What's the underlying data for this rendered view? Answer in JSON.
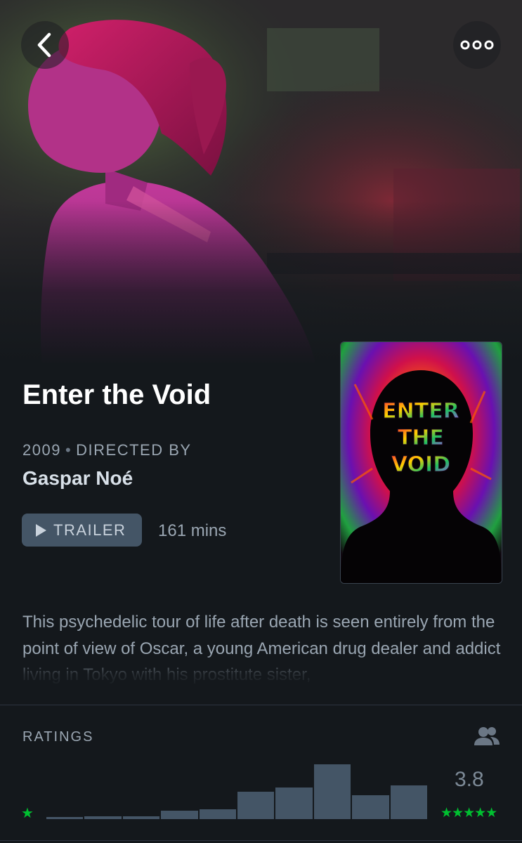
{
  "header": {
    "back_icon": "chevron-left-icon",
    "more_icon": "more-options-icon"
  },
  "film": {
    "title": "Enter the Void",
    "year": "2009",
    "directed_by_label": "DIRECTED BY",
    "director": "Gaspar Noé",
    "trailer_label": "TRAILER",
    "runtime": "161 mins",
    "poster_text": "ENTER THE VOID",
    "synopsis": "This psychedelic tour of life after death is seen entirely from the point of view of Oscar, a young American drug dealer and addict living in Tokyo with his prostitute sister,"
  },
  "ratings": {
    "label": "RATINGS",
    "icon": "fans-icon",
    "min_star": "★",
    "average": "3.8",
    "max_stars": "★★★★★",
    "accent_color": "#00c030",
    "bar_color": "#445566",
    "histogram_share": [
      0.04,
      0.05,
      0.05,
      0.15,
      0.18,
      0.5,
      0.58,
      1.0,
      0.44,
      0.62
    ]
  }
}
